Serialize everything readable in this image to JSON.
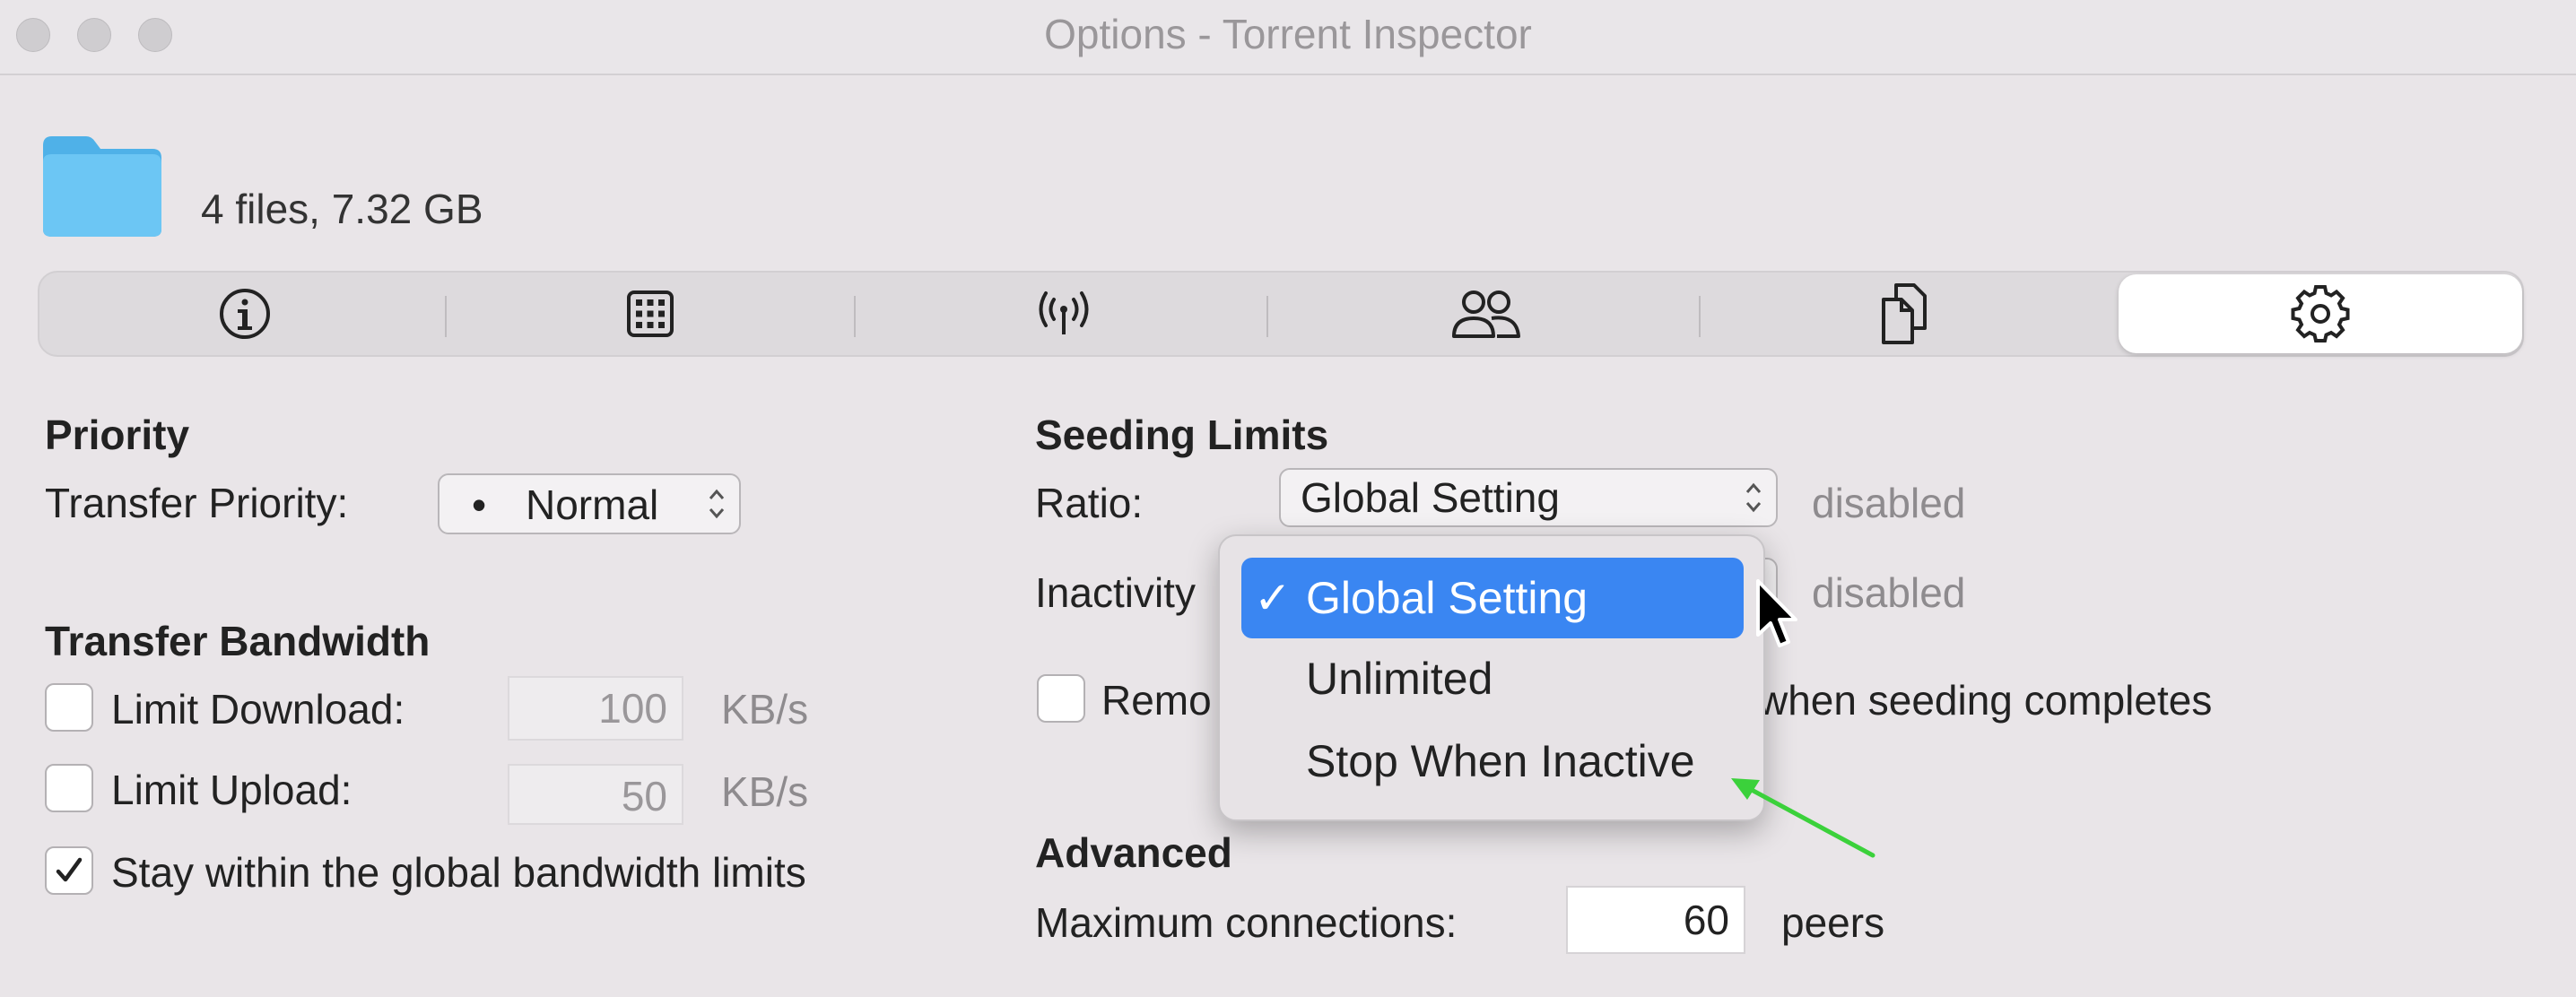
{
  "window": {
    "title": "Options - Torrent Inspector"
  },
  "header": {
    "files_summary": "4 files, 7.32 GB",
    "folder_color": "#5cbcf0"
  },
  "tabs": [
    {
      "icon": "info-icon",
      "selected": false
    },
    {
      "icon": "grid-icon",
      "selected": false
    },
    {
      "icon": "antenna-icon",
      "selected": false
    },
    {
      "icon": "people-icon",
      "selected": false
    },
    {
      "icon": "files-icon",
      "selected": false
    },
    {
      "icon": "gear-icon",
      "selected": true
    }
  ],
  "priority": {
    "title": "Priority",
    "transfer_label": "Transfer Priority:",
    "value_bullet": "•",
    "value": "Normal"
  },
  "bandwidth": {
    "title": "Transfer Bandwidth",
    "limit_download_label": "Limit Download:",
    "limit_download_checked": false,
    "download_value": "100",
    "download_unit": "KB/s",
    "limit_upload_label": "Limit Upload:",
    "limit_upload_checked": false,
    "upload_value": "50",
    "upload_unit": "KB/s",
    "stay_global_label": "Stay within the global bandwidth limits",
    "stay_global_checked": true
  },
  "seeding": {
    "title": "Seeding Limits",
    "ratio_label": "Ratio:",
    "ratio_value": "Global Setting",
    "ratio_status": "disabled",
    "inactivity_label": "Inactivity",
    "inactivity_status": "disabled",
    "remove_label_start": "Remo",
    "remove_label_end": "when seeding completes",
    "remove_checked": false
  },
  "inactivity_menu": {
    "items": [
      {
        "label": "Global Setting",
        "checked": true,
        "highlighted": true
      },
      {
        "label": "Unlimited",
        "checked": false,
        "highlighted": false
      },
      {
        "label": "Stop When Inactive",
        "checked": false,
        "highlighted": false
      }
    ],
    "check_mark": "✓",
    "highlight_color": "#3a86f2"
  },
  "advanced": {
    "title": "Advanced",
    "max_connections_label": "Maximum connections:",
    "max_connections_value": "60",
    "max_connections_unit": "peers"
  },
  "annotation": {
    "arrow_color": "#3bd13b"
  }
}
